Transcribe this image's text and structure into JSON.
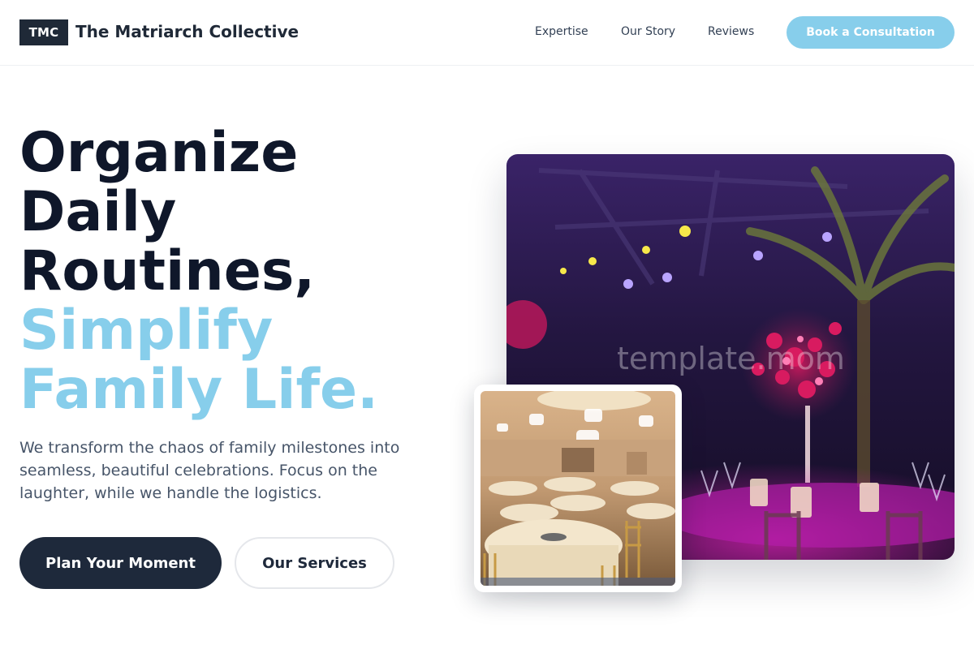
{
  "header": {
    "logo_text": "TMC",
    "brand_name": "The Matriarch Collective",
    "nav": [
      "Expertise",
      "Our Story",
      "Reviews"
    ],
    "cta_label": "Book a Consultation"
  },
  "hero": {
    "headline_lines": [
      "Organize",
      "Daily",
      "Routines,"
    ],
    "accent_lines": [
      "Simplify",
      "Family Life."
    ],
    "subtext": "We transform the chaos of family milestones into seamless, beautiful celebrations. Focus on the laughter, while we handle the logistics.",
    "primary_button": "Plan Your Moment",
    "secondary_button": "Our Services"
  },
  "images": {
    "main_alt": "Event venue with purple lighting and floral centerpieces",
    "inset_alt": "Banquet hall with round tables and chandeliers",
    "watermark": "template.mom"
  },
  "colors": {
    "accent": "#87ceeb",
    "dark": "#1e293b",
    "text": "#0f172a",
    "muted": "#475569"
  }
}
